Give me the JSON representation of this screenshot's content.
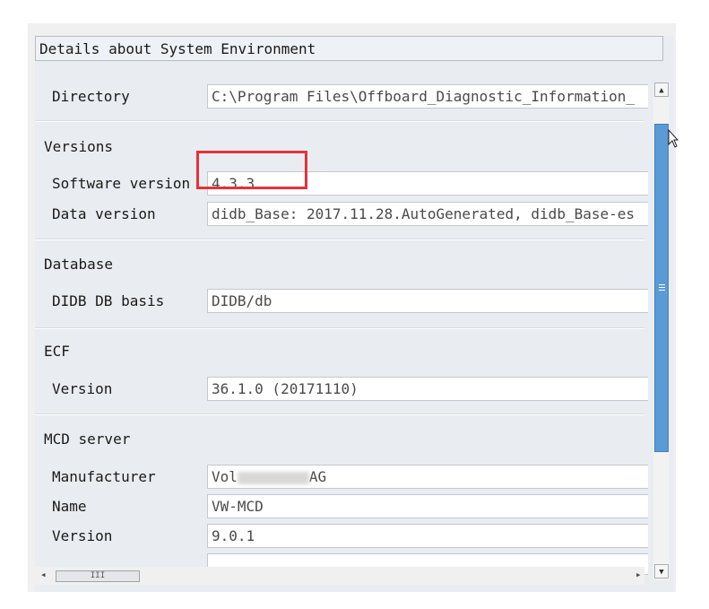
{
  "header": {
    "title": "Details about System Environment"
  },
  "directory": {
    "label": "Directory",
    "value": "C:\\Program Files\\Offboard_Diagnostic_Information_"
  },
  "versions": {
    "heading": "Versions",
    "software_label": "Software version",
    "software_value": "4.3.3",
    "data_label": "Data version",
    "data_value": "didb_Base: 2017.11.28.AutoGenerated, didb_Base-es"
  },
  "database": {
    "heading": "Database",
    "didb_label": "DIDB DB basis",
    "didb_value": "DIDB/db"
  },
  "ecf": {
    "heading": "ECF",
    "version_label": "Version",
    "version_value": "36.1.0 (20171110)"
  },
  "mcd": {
    "heading": "MCD server",
    "manufacturer_label": "Manufacturer",
    "manufacturer_prefix": "Vol",
    "manufacturer_suffix": "AG",
    "name_label": "Name",
    "name_value": "VW-MCD",
    "version_label": "Version",
    "version_value": "9.0.1"
  },
  "scroll": {
    "up_arrow": "▲",
    "down_arrow": "▼",
    "left_arrow": "◂",
    "right_arrow": "▸",
    "grip": "III"
  },
  "colors": {
    "highlight": "#e5323b",
    "scroll_thumb": "#5b9bd5"
  }
}
